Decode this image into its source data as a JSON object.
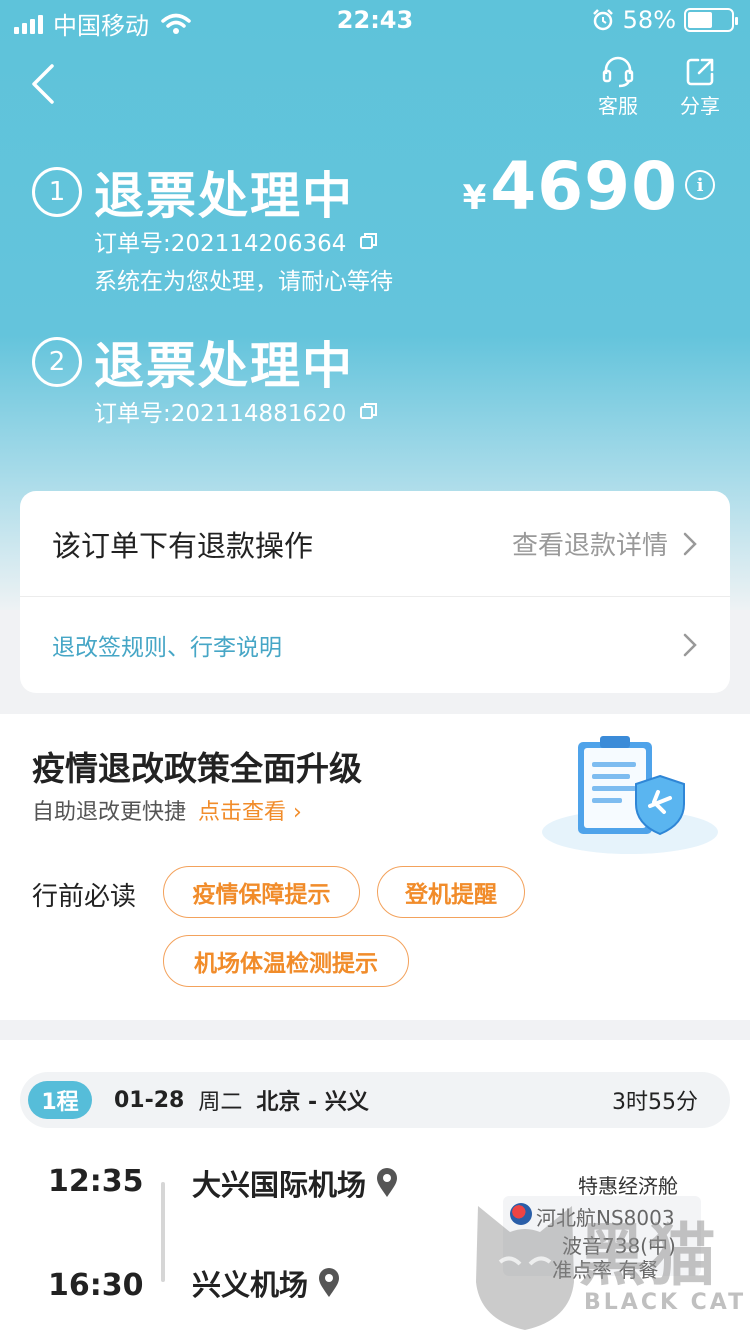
{
  "status_bar": {
    "carrier": "中国移动",
    "time": "22:43",
    "battery": "58%",
    "battery_level": 0.58
  },
  "header": {
    "service_label": "客服",
    "share_label": "分享"
  },
  "orders": [
    {
      "num": "1",
      "status": "退票处理中",
      "order_no": "订单号:202114206364",
      "note": "系统在为您处理，请耐心等待"
    },
    {
      "num": "2",
      "status": "退票处理中",
      "order_no": "订单号:202114881620"
    }
  ],
  "price": {
    "currency": "¥",
    "amount": "4690"
  },
  "refund_card": {
    "title": "该订单下有退款操作",
    "link": "查看退款详情",
    "rules_link": "退改签规则、行李说明"
  },
  "policy": {
    "title": "疫情退改政策全面升级",
    "subtitle": "自助退改更快捷",
    "cta": "点击查看 ›",
    "must_read_label": "行前必读",
    "tags": [
      "疫情保障提示",
      "登机提醒",
      "机场体温检测提示"
    ]
  },
  "trip": {
    "badge": "1程",
    "date": "01-28",
    "weekday": "周二",
    "route": "北京 - 兴义",
    "duration": "3时55分",
    "departure": {
      "time": "12:35",
      "airport": "大兴国际机场"
    },
    "arrival": {
      "time": "16:30",
      "airport": "兴义机场"
    },
    "cabin": "特惠经济舱",
    "flight": "河北航NS8003",
    "aircraft": "波音738(中)",
    "punctuality": "准点率  有餐"
  },
  "watermark": {
    "cn": "黑猫",
    "en": "BLACK CAT"
  },
  "colors": {
    "hero": "#5ec3da",
    "accent_orange": "#f18c2a",
    "link_blue": "#46a6c6",
    "trip_badge": "#56bdd9"
  }
}
